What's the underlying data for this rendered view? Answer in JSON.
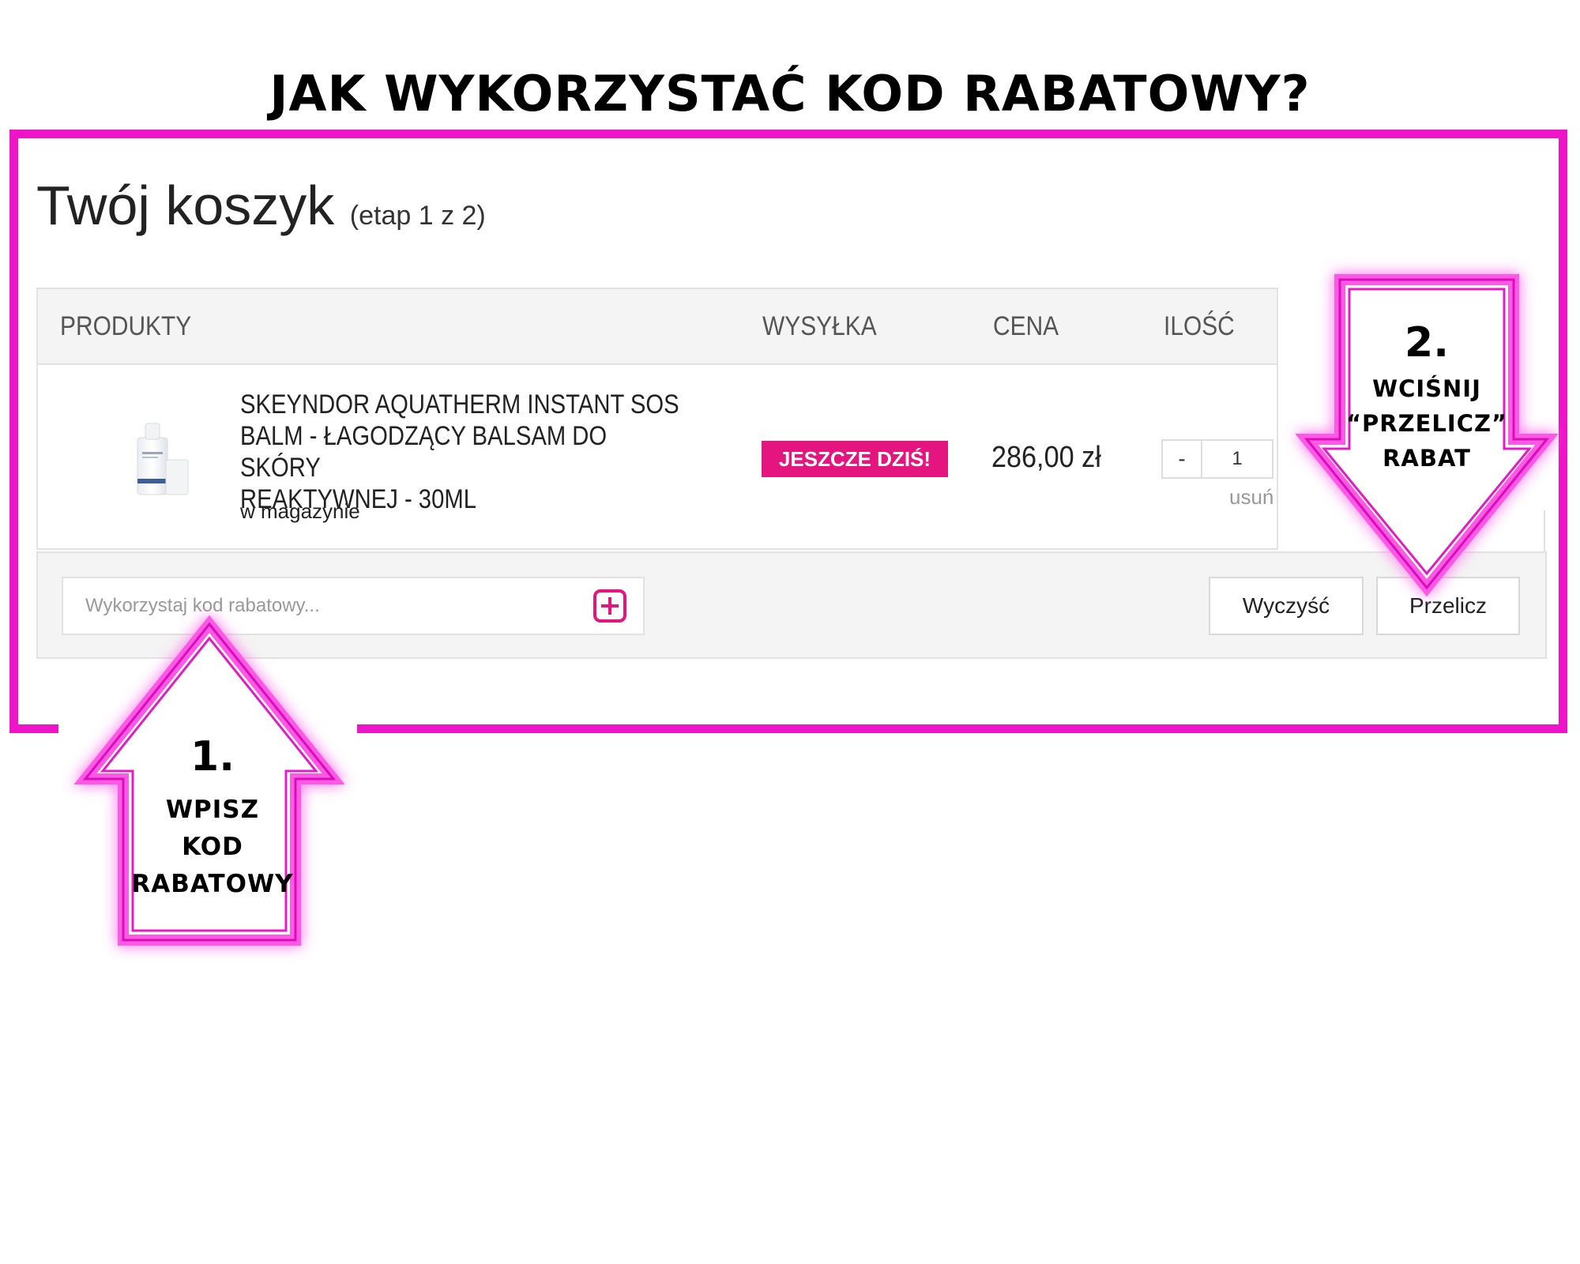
{
  "heading": "JAK WYKORZYSTAĆ KOD RABATOWY?",
  "cart": {
    "title": "Twój koszyk",
    "step": "(etap 1 z 2)",
    "columns": [
      "PRODUKTY",
      "WYSYŁKA",
      "CENA",
      "ILOŚĆ"
    ],
    "item": {
      "name_lines": [
        "SKEYNDOR AQUATHERM INSTANT SOS",
        "BALM - ŁAGODZĄCY BALSAM DO SKÓRY",
        "REAKTYWNEJ - 30ML"
      ],
      "availability": "w magazynie",
      "shipping_badge": "JESZCZE DZIŚ!",
      "price": "286,00 zł",
      "qty_minus": "-",
      "quantity": "1",
      "remove": "usuń"
    },
    "coupon_placeholder": "Wykorzystaj kod rabatowy...",
    "clear_button": "Wyczyść",
    "recalc_button": "Przelicz"
  },
  "step1": {
    "number": "1.",
    "lines": [
      "WPISZ",
      "KOD",
      "RABATOWY"
    ]
  },
  "step2": {
    "number": "2.",
    "lines": [
      "WCIŚNIJ",
      "“PRZELICZ”",
      "RABAT"
    ]
  },
  "colors": {
    "frame": "#ee14c8",
    "badge": "#e5157f",
    "accent_icon": "#e5157f",
    "neon": "#ff4fe0"
  },
  "icons": {
    "coupon_add": "plus-square-icon",
    "step1_arrow": "arrow-up-icon",
    "step2_arrow": "arrow-down-icon"
  }
}
